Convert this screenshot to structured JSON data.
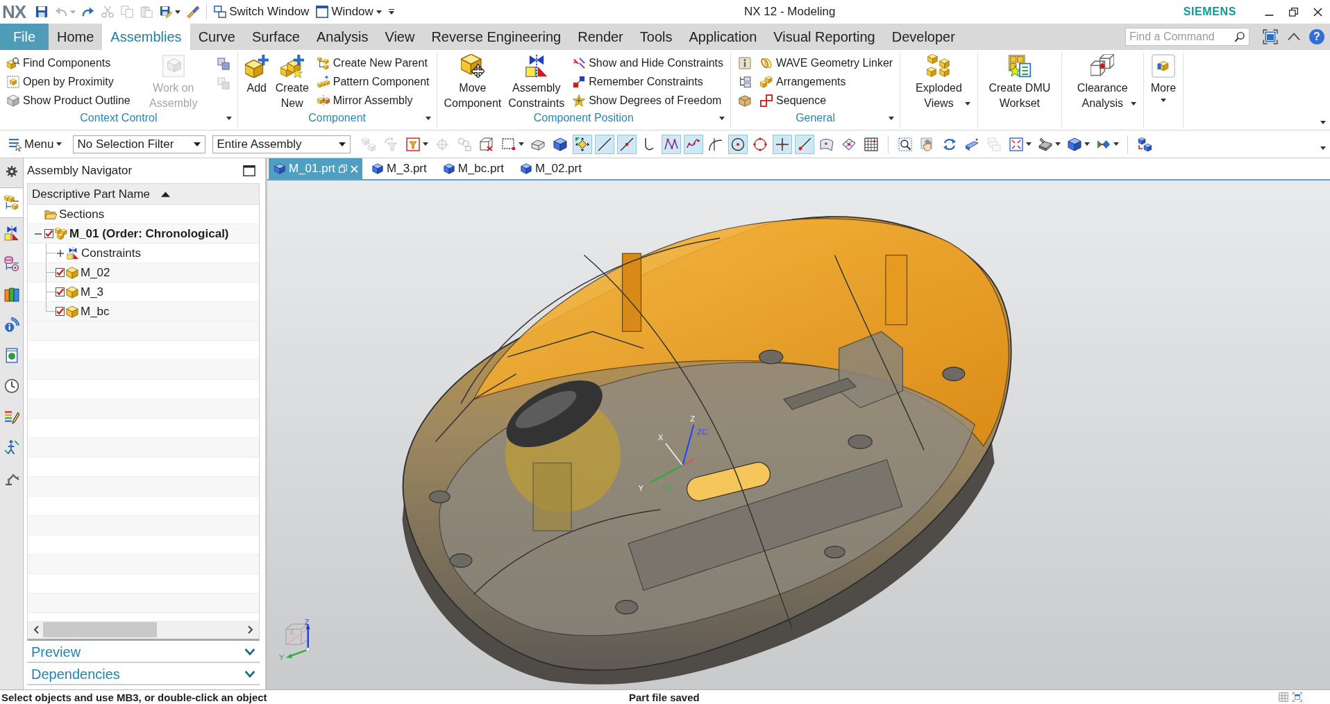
{
  "title_bar": {
    "logo": "NX",
    "quick_access": [
      {
        "kind": "save",
        "disabled": false,
        "dropdown": false
      },
      {
        "kind": "undo",
        "disabled": true,
        "dropdown": true
      },
      {
        "kind": "redo",
        "disabled": false,
        "dropdown": false
      },
      {
        "kind": "cut",
        "disabled": true,
        "dropdown": false
      },
      {
        "kind": "copy",
        "disabled": true,
        "dropdown": false
      },
      {
        "kind": "paste",
        "disabled": true,
        "dropdown": false
      },
      {
        "kind": "saveas",
        "disabled": false,
        "dropdown": true
      },
      {
        "kind": "brush",
        "disabled": false,
        "dropdown": false
      }
    ],
    "commands": [
      {
        "kind": "switch",
        "label": "Switch Window",
        "dropdown": false
      },
      {
        "kind": "window",
        "label": "Window",
        "dropdown": true
      }
    ],
    "title": "NX 12 - Modeling",
    "brand": "SIEMENS"
  },
  "ribbon_bar": {
    "tabs": [
      {
        "kind": "file",
        "label": "File",
        "selected": false
      },
      {
        "kind": "tab",
        "label": "Home",
        "selected": false
      },
      {
        "kind": "tab",
        "label": "Assemblies",
        "selected": true
      },
      {
        "kind": "tab",
        "label": "Curve",
        "selected": false
      },
      {
        "kind": "tab",
        "label": "Surface",
        "selected": false
      },
      {
        "kind": "tab",
        "label": "Analysis",
        "selected": false
      },
      {
        "kind": "tab",
        "label": "View",
        "selected": false
      },
      {
        "kind": "tab",
        "label": "Reverse Engineering",
        "selected": false
      },
      {
        "kind": "tab",
        "label": "Render",
        "selected": false
      },
      {
        "kind": "tab",
        "label": "Tools",
        "selected": false
      },
      {
        "kind": "tab",
        "label": "Application",
        "selected": false
      },
      {
        "kind": "tab",
        "label": "Visual Reporting",
        "selected": false
      },
      {
        "kind": "tab",
        "label": "Developer",
        "selected": false
      }
    ],
    "search": {
      "placeholder": "Find a Command"
    },
    "help": "?"
  },
  "ribbon": {
    "groups": [
      {
        "label": "Context Control",
        "menu": true,
        "columns": [
          {
            "kind": "small",
            "buttons": [
              {
                "kind": "find",
                "label": "Find Components",
                "disabled": false
              },
              {
                "kind": "proximity",
                "label": "Open by Proximity",
                "disabled": false
              },
              {
                "kind": "outline",
                "label": "Show Product Outline",
                "disabled": false
              }
            ]
          },
          {
            "kind": "large",
            "buttons": [
              {
                "kind": "workon",
                "label": "Work on Assembly",
                "disabled": true,
                "dropdown": false
              }
            ]
          },
          {
            "kind": "icons",
            "buttons": [
              {
                "kind": "squares",
                "disabled": false
              },
              {
                "kind": "squares",
                "disabled": true
              }
            ]
          }
        ]
      },
      {
        "label": "Component",
        "menu": true,
        "columns": [
          {
            "kind": "large",
            "buttons": [
              {
                "kind": "add",
                "label": "Add",
                "disabled": false,
                "dropdown": false
              },
              {
                "kind": "createnew",
                "label": "Create New",
                "disabled": false,
                "dropdown": false
              }
            ]
          },
          {
            "kind": "small",
            "buttons": [
              {
                "kind": "parent",
                "label": "Create New Parent",
                "disabled": false
              },
              {
                "kind": "pattern",
                "label": "Pattern Component",
                "disabled": false
              },
              {
                "kind": "mirror",
                "label": "Mirror Assembly",
                "disabled": false
              }
            ]
          }
        ]
      },
      {
        "label": "Component Position",
        "menu": true,
        "columns": [
          {
            "kind": "large",
            "buttons": [
              {
                "kind": "move",
                "label": "Move Component",
                "disabled": false,
                "dropdown": false
              },
              {
                "kind": "constraints",
                "label": "Assembly Constraints",
                "disabled": false,
                "dropdown": false
              }
            ]
          },
          {
            "kind": "small",
            "buttons": [
              {
                "kind": "showhide",
                "label": "Show and Hide Constraints",
                "disabled": false
              },
              {
                "kind": "remember",
                "label": "Remember Constraints",
                "disabled": false
              },
              {
                "kind": "dof",
                "label": "Show Degrees of Freedom",
                "disabled": false
              }
            ]
          }
        ]
      },
      {
        "label": "General",
        "menu": true,
        "columns": [
          {
            "kind": "icons",
            "buttons": [
              {
                "kind": "info",
                "disabled": false
              },
              {
                "kind": "tree",
                "disabled": false
              },
              {
                "kind": "stack",
                "disabled": false
              }
            ]
          },
          {
            "kind": "small",
            "buttons": [
              {
                "kind": "wave",
                "label": "WAVE Geometry Linker",
                "disabled": false
              },
              {
                "kind": "arrange",
                "label": "Arrangements",
                "disabled": false
              },
              {
                "kind": "sequence",
                "label": "Sequence",
                "disabled": false
              }
            ]
          }
        ]
      },
      {
        "menu": false,
        "columns": [
          {
            "kind": "large",
            "buttons": [
              {
                "kind": "exploded",
                "label": "Exploded Views",
                "disabled": false,
                "dropdown": true
              }
            ]
          }
        ]
      },
      {
        "menu": false,
        "columns": [
          {
            "kind": "large",
            "buttons": [
              {
                "kind": "dmu",
                "label": "Create DMU Workset",
                "disabled": false,
                "dropdown": false
              }
            ]
          }
        ]
      },
      {
        "menu": false,
        "columns": [
          {
            "kind": "large",
            "buttons": [
              {
                "kind": "clearance",
                "label": "Clearance Analysis",
                "disabled": false,
                "dropdown": true
              }
            ]
          }
        ]
      },
      {
        "menu": false,
        "columns": [
          {
            "kind": "large",
            "buttons": [
              {
                "kind": "more",
                "label": "More",
                "disabled": false,
                "dropdown": true
              }
            ]
          }
        ]
      }
    ]
  },
  "toolbar": {
    "menu": {
      "label": "Menu"
    },
    "selection_filter": {
      "value": "No Selection Filter"
    },
    "scope": {
      "value": "Entire Assembly"
    },
    "tool_groups": [
      {
        "tools": [
          {
            "kind": "asmfilter",
            "on": false,
            "disabled": true,
            "dropdown": false
          },
          {
            "kind": "funnel",
            "on": false,
            "disabled": true,
            "dropdown": false
          },
          {
            "kind": "typefilter",
            "on": false,
            "disabled": false,
            "dropdown": true
          },
          {
            "kind": "crosshair",
            "on": false,
            "disabled": true,
            "dropdown": false
          },
          {
            "kind": "chain",
            "on": false,
            "disabled": true,
            "dropdown": false
          },
          {
            "kind": "snapcube",
            "on": false,
            "disabled": false,
            "dropdown": false
          },
          {
            "kind": "rectsel",
            "on": false,
            "disabled": false,
            "dropdown": true
          },
          {
            "kind": "block",
            "on": false,
            "disabled": false,
            "dropdown": false
          },
          {
            "kind": "bluecube",
            "on": false,
            "disabled": false,
            "dropdown": false
          },
          {
            "kind": "snap",
            "on": true,
            "disabled": false,
            "dropdown": false
          },
          {
            "kind": "line",
            "on": true,
            "disabled": false,
            "dropdown": false
          },
          {
            "kind": "linemid",
            "on": true,
            "disabled": false,
            "dropdown": false
          },
          {
            "kind": "hook",
            "on": false,
            "disabled": false,
            "dropdown": false
          },
          {
            "kind": "poly",
            "on": true,
            "disabled": false,
            "dropdown": false
          },
          {
            "kind": "spline",
            "on": true,
            "disabled": false,
            "dropdown": false
          },
          {
            "kind": "tangent",
            "on": false,
            "disabled": false,
            "dropdown": false
          },
          {
            "kind": "circlecenter",
            "on": true,
            "disabled": false,
            "dropdown": false
          },
          {
            "kind": "circlequad",
            "on": false,
            "disabled": false,
            "dropdown": false
          },
          {
            "kind": "cross",
            "on": true,
            "disabled": false,
            "dropdown": false
          },
          {
            "kind": "linedot",
            "on": true,
            "disabled": false,
            "dropdown": false
          },
          {
            "kind": "surfpt",
            "on": false,
            "disabled": false,
            "dropdown": false
          },
          {
            "kind": "mesh",
            "on": false,
            "disabled": false,
            "dropdown": false
          },
          {
            "kind": "grid",
            "on": false,
            "disabled": false,
            "dropdown": false
          }
        ]
      },
      {
        "tools": [
          {
            "kind": "zoom",
            "on": false,
            "disabled": false,
            "dropdown": false
          },
          {
            "kind": "pan",
            "on": false,
            "disabled": false,
            "dropdown": false
          },
          {
            "kind": "rotate",
            "on": false,
            "disabled": false,
            "dropdown": false
          },
          {
            "kind": "ray",
            "on": false,
            "disabled": false,
            "dropdown": false
          },
          {
            "kind": "layers",
            "on": false,
            "disabled": true,
            "dropdown": false
          },
          {
            "kind": "fit",
            "on": false,
            "disabled": false,
            "dropdown": true
          },
          {
            "kind": "shade",
            "on": false,
            "disabled": false,
            "dropdown": true
          },
          {
            "kind": "cube",
            "on": false,
            "disabled": false,
            "dropdown": true
          },
          {
            "kind": "arrowview",
            "on": false,
            "disabled": false,
            "dropdown": true
          }
        ]
      },
      {
        "tools": [
          {
            "kind": "cubes",
            "on": false,
            "disabled": false,
            "dropdown": false
          }
        ]
      }
    ]
  },
  "resource_bar": [
    {
      "kind": "asmtree",
      "selected": true
    },
    {
      "kind": "constraints",
      "selected": false
    },
    {
      "kind": "parts",
      "selected": false
    },
    {
      "kind": "library",
      "selected": false
    },
    {
      "kind": "hd3d",
      "selected": false
    },
    {
      "kind": "browser",
      "selected": false
    },
    {
      "kind": "history",
      "selected": false
    },
    {
      "kind": "materials",
      "selected": false
    },
    {
      "kind": "process",
      "selected": false
    },
    {
      "kind": "roles",
      "selected": false
    }
  ],
  "navigator": {
    "title": "Assembly Navigator",
    "column": {
      "label": "Descriptive Part Name",
      "ascending": true
    },
    "tree": [
      {
        "kind": "folder",
        "label": "Sections",
        "active": false
      },
      {
        "kind": "assembly",
        "label": "M_01 (Order: Chronological)",
        "active": true,
        "checked": true,
        "expanded": true,
        "children": [
          {
            "kind": "constraints",
            "label": "Constraints",
            "active": false,
            "expanded": false
          },
          {
            "kind": "part",
            "label": "M_02",
            "active": false,
            "checked": true
          },
          {
            "kind": "part",
            "label": "M_3",
            "active": false,
            "checked": true
          },
          {
            "kind": "part",
            "label": "M_bc",
            "active": false,
            "checked": true
          }
        ]
      }
    ],
    "sections": [
      {
        "label": "Preview",
        "expanded": false
      },
      {
        "label": "Dependencies",
        "expanded": false
      }
    ]
  },
  "document_tabs": [
    {
      "label": "M_01.prt",
      "selected": true
    },
    {
      "label": "M_3.prt",
      "selected": false
    },
    {
      "label": "M_bc.prt",
      "selected": false
    },
    {
      "label": "M_02.prt",
      "selected": false
    }
  ],
  "viewport": {
    "csys_labels": [
      {
        "kind": "z",
        "text": "Z"
      },
      {
        "kind": "zc",
        "text": "ZC"
      },
      {
        "kind": "x",
        "text": "X"
      },
      {
        "kind": "y",
        "text": "Y"
      },
      {
        "kind": "yc",
        "text": "YC"
      }
    ],
    "view_triad_labels": [
      {
        "kind": "z",
        "text": "Z"
      },
      {
        "kind": "y",
        "text": "Y"
      },
      {
        "kind": "x",
        "text": "X"
      }
    ]
  },
  "status_bar": {
    "prompt": "Select objects and use MB3, or double-click an object",
    "message": "Part file saved"
  }
}
